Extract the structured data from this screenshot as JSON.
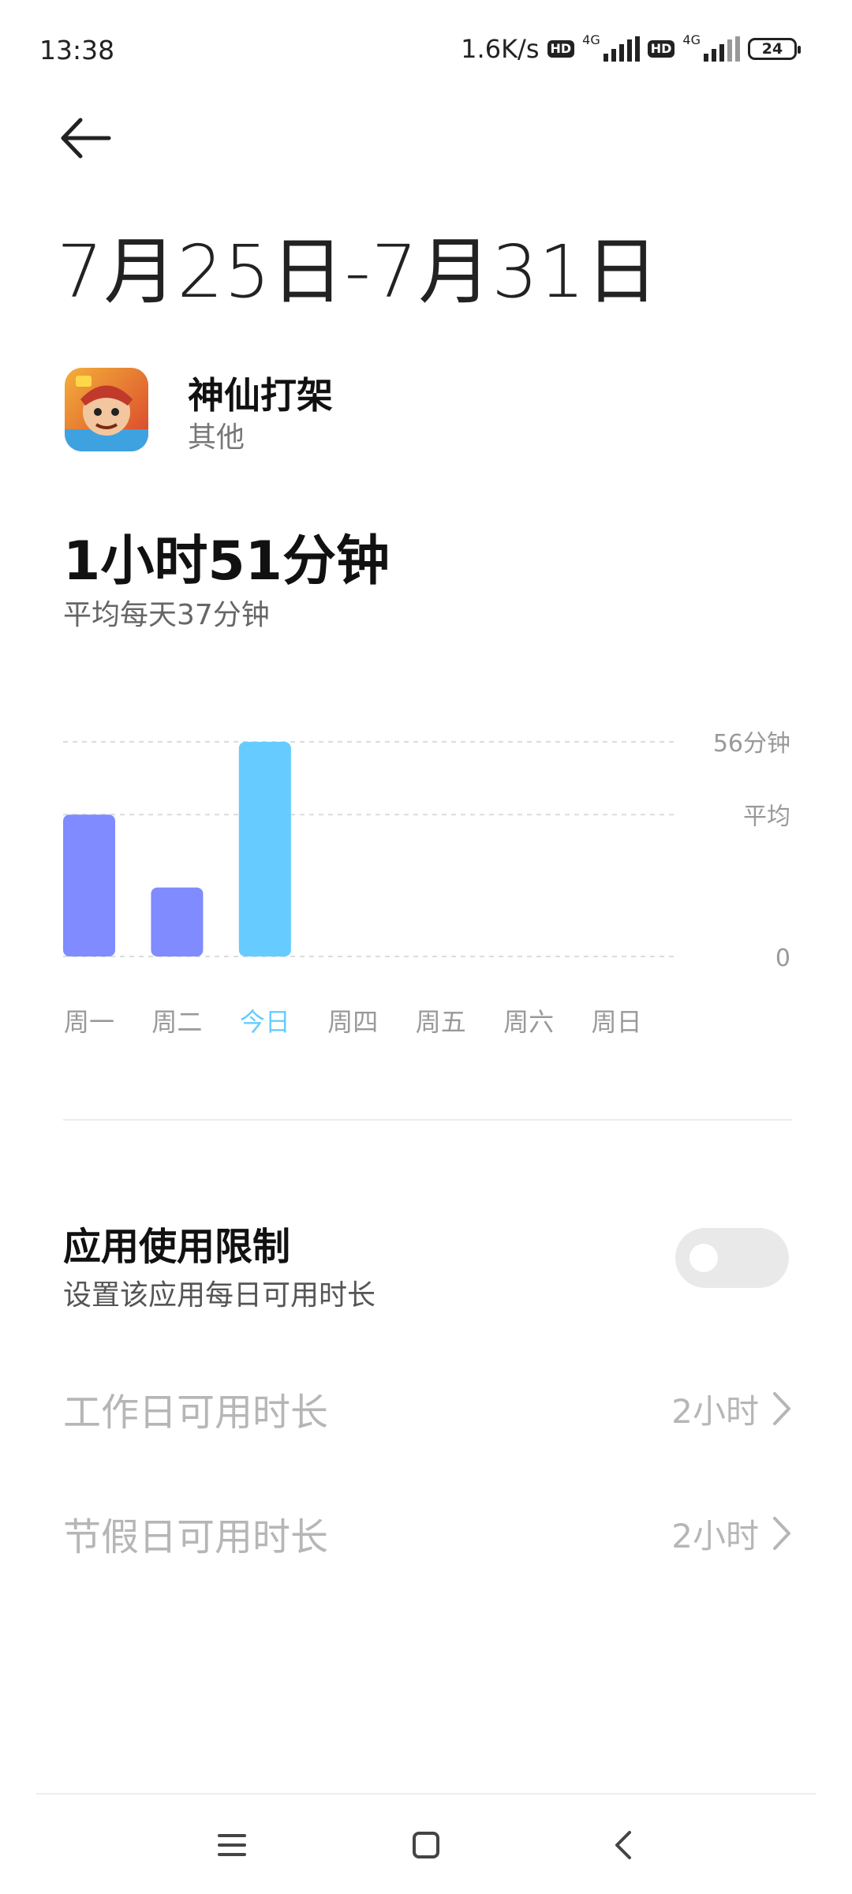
{
  "status_bar": {
    "time": "13:38",
    "speed": "1.6K/s",
    "sim1_label": "4G",
    "sim2_label": "4G",
    "hd": "HD",
    "battery": "24"
  },
  "header": {
    "back_icon": "arrow-left-icon",
    "date_range": "7月25日-7月31日"
  },
  "app": {
    "name": "神仙打架",
    "category": "其他"
  },
  "usage": {
    "total": "1小时51分钟",
    "average": "平均每天37分钟"
  },
  "chart_data": {
    "type": "bar",
    "categories": [
      "周一",
      "周二",
      "今日",
      "周四",
      "周五",
      "周六",
      "周日"
    ],
    "values": [
      37,
      18,
      56,
      null,
      null,
      null,
      null
    ],
    "highlight_index": 2,
    "highlight_color": "#66ccff",
    "bar_color": "#7f8bff",
    "ylim": [
      0,
      56
    ],
    "y_tick_labels": [
      "56分钟",
      "平均",
      "0"
    ],
    "y_tick_values": [
      56,
      37,
      0
    ],
    "grid": "dashed"
  },
  "limit": {
    "title": "应用使用限制",
    "subtitle": "设置该应用每日可用时长",
    "enabled": false
  },
  "rows": [
    {
      "label": "工作日可用时长",
      "value": "2小时"
    },
    {
      "label": "节假日可用时长",
      "value": "2小时"
    }
  ],
  "nav": {
    "menu_icon": "menu-icon",
    "home_icon": "home-square-icon",
    "back_icon": "back-chevron-icon"
  }
}
